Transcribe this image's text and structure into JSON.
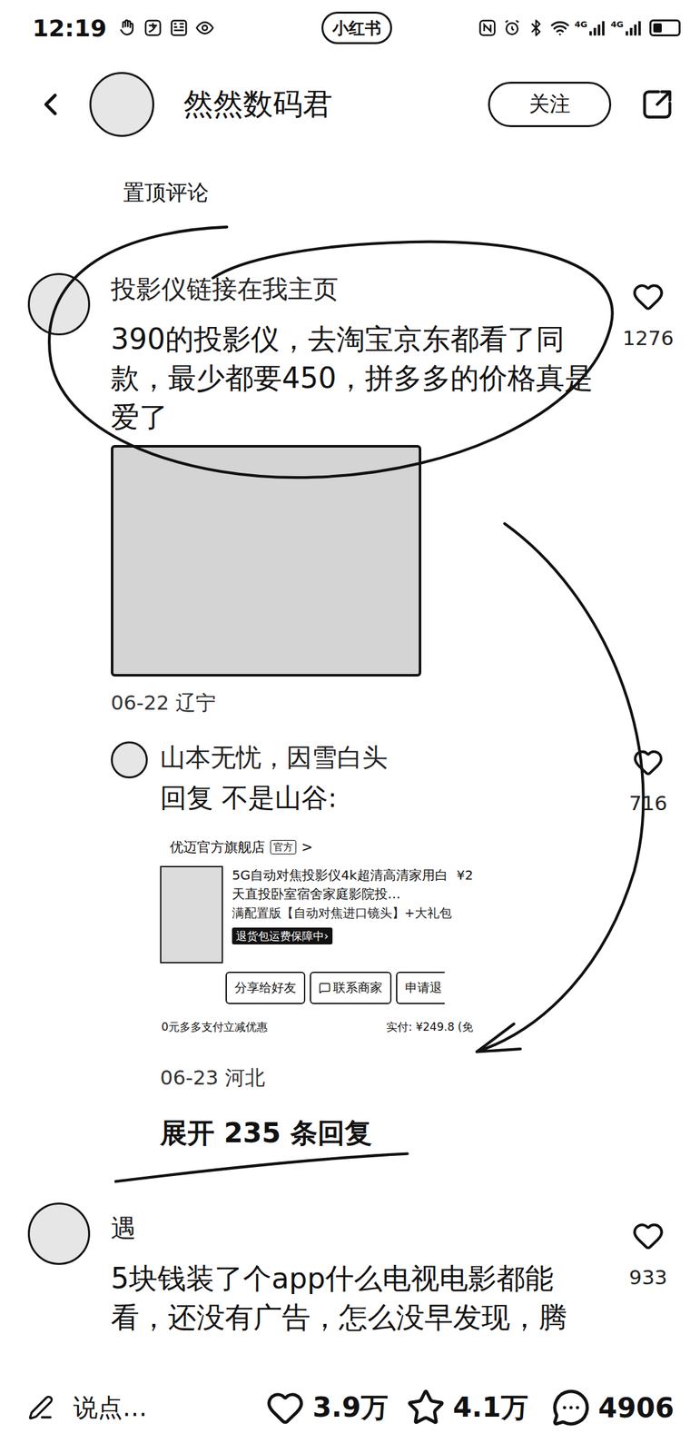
{
  "status_bar": {
    "time": "12:19",
    "app_badge": "小红书",
    "network": [
      "4G",
      "4G"
    ],
    "battery_level": 0.35
  },
  "header": {
    "author": "然然数码君",
    "follow_button": "关注",
    "followed": false
  },
  "pinned_label": "置顶评论",
  "comments": [
    {
      "user": "投影仪链接在我主页",
      "text": "390的投影仪，去淘宝京东都看了同款，最少都要450，拼多多的价格真是爱了",
      "has_image": true,
      "meta": "06-22 辽宁",
      "likes": "1276",
      "liked": false,
      "replies": [
        {
          "user": "山本无忧，因雪白头",
          "text": "回复 不是山谷:",
          "likes": "716",
          "liked": false,
          "meta": "06-23 河北",
          "order_card": {
            "shop": "优迈官方旗舰店",
            "shop_tag": "官方",
            "shop_arrow": ">",
            "title": "5G自动对焦投影仪4k超清高清家用白天直投卧室宿舍家庭影院投…",
            "price": "¥2",
            "spec": "满配置版【自动对焦进口镜头】+大礼包",
            "badge": "退货包运费保障中›",
            "buttons": [
              {
                "label": "分享给好友",
                "cut": false,
                "kind": "plain"
              },
              {
                "label": "联系商家",
                "cut": false,
                "kind": "chat"
              },
              {
                "label": "申请退",
                "cut": true,
                "kind": "plain"
              }
            ],
            "promo": "0元多多支付立减优惠",
            "paid": "实付: ¥249.8 (免"
          }
        }
      ],
      "expand": "展开 235 条回复"
    },
    {
      "user": "遇",
      "text": "5块钱装了个app什么电视电影都能看，还没有广告，怎么没早发现，腾",
      "has_image": false,
      "likes": "933",
      "liked": false,
      "replies": []
    }
  ],
  "bottom_bar": {
    "input_placeholder": "说点…",
    "likes": "3.9万",
    "favorites": "4.1万",
    "comments": "4906"
  }
}
